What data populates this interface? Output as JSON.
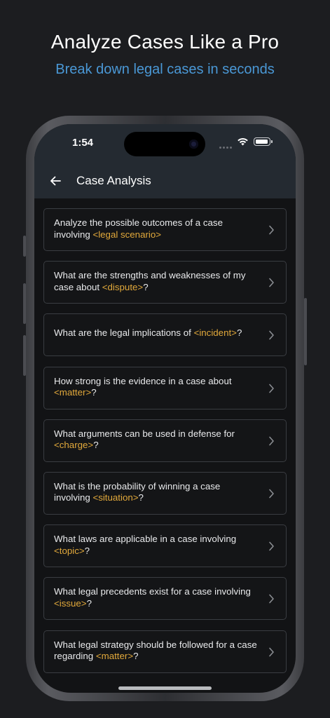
{
  "promo": {
    "title": "Analyze Cases Like a Pro",
    "subtitle": "Break down legal cases in seconds"
  },
  "status_bar": {
    "time": "1:54",
    "icons": [
      "cellular-dots-icon",
      "wifi-icon",
      "battery-icon"
    ]
  },
  "nav": {
    "back_icon": "arrow-left-icon",
    "title": "Case Analysis"
  },
  "colors": {
    "background": "#1c1d20",
    "accent_blue": "#4a98d6",
    "placeholder": "#e2a93b",
    "card_border": "#3a3d42"
  },
  "prompts": [
    {
      "before": "Analyze the possible outcomes of a case involving ",
      "placeholder": "<legal scenario>",
      "after": ""
    },
    {
      "before": "What are the strengths and weaknesses of my case about ",
      "placeholder": "<dispute>",
      "after": "?"
    },
    {
      "before": "What are the legal implications of ",
      "placeholder": "<incident>",
      "after": "?"
    },
    {
      "before": "How strong is the evidence in a case about ",
      "placeholder": "<matter>",
      "after": "?"
    },
    {
      "before": "What arguments can be used in defense for ",
      "placeholder": "<charge>",
      "after": "?"
    },
    {
      "before": "What is the probability of winning a case involving ",
      "placeholder": "<situation>",
      "after": "?"
    },
    {
      "before": "What laws are applicable in a case involving ",
      "placeholder": "<topic>",
      "after": "?"
    },
    {
      "before": "What legal precedents exist for a case involving ",
      "placeholder": "<issue>",
      "after": "?"
    },
    {
      "before": "What legal strategy should be followed for a case regarding ",
      "placeholder": "<matter>",
      "after": "?"
    }
  ]
}
